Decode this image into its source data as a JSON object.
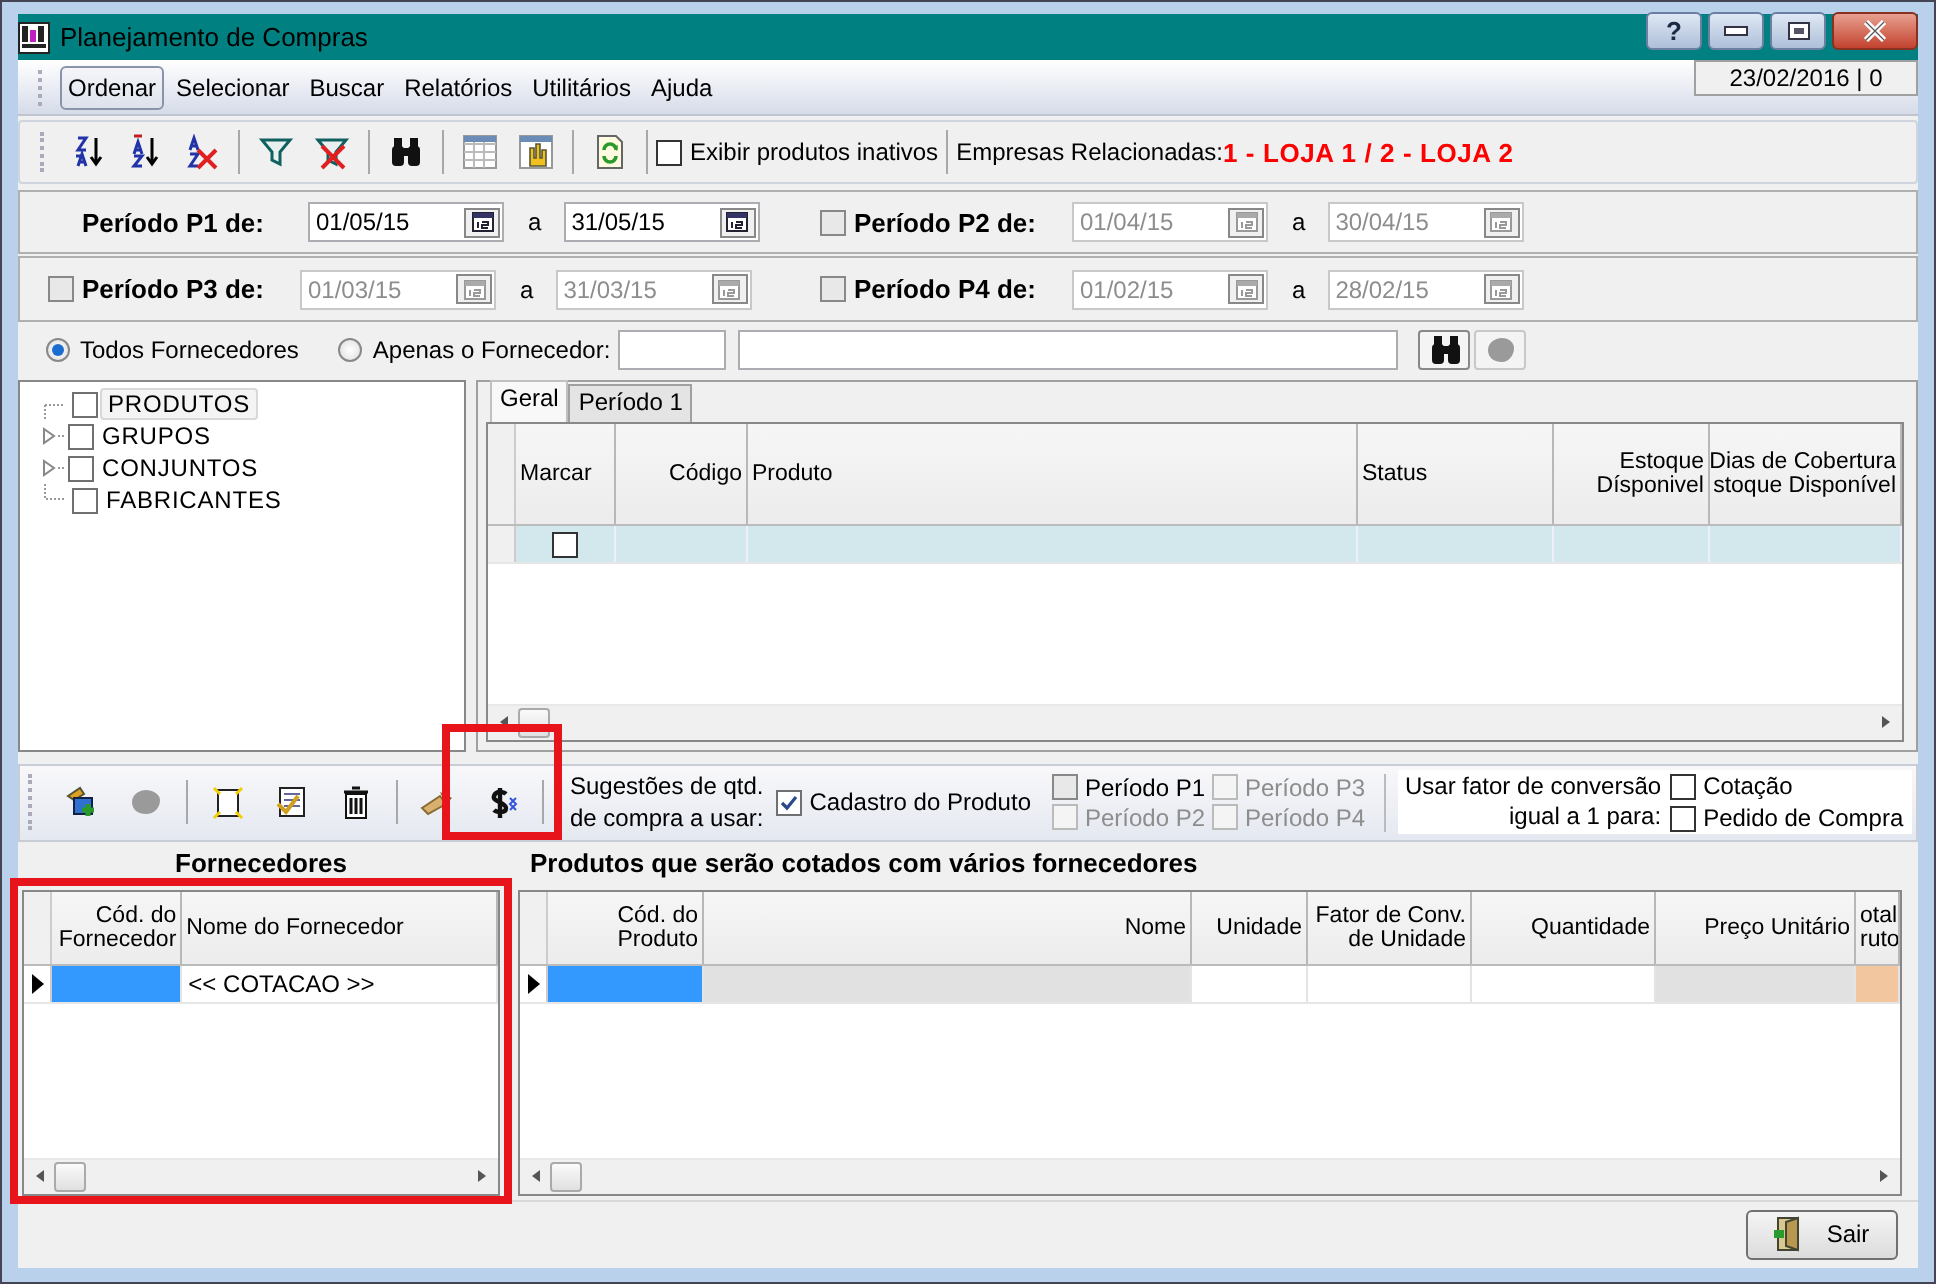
{
  "window": {
    "title": "Planejamento de Compras",
    "help": "?"
  },
  "menu": [
    {
      "label": "Ordenar",
      "selected": true
    },
    {
      "label": "Selecionar",
      "selected": false
    },
    {
      "label": "Buscar",
      "selected": false
    },
    {
      "label": "Relatórios",
      "selected": false
    },
    {
      "label": "Utilitários",
      "selected": false
    },
    {
      "label": "Ajuda",
      "selected": false
    }
  ],
  "date_box": "23/02/2016 | 0",
  "toolbar": {
    "show_inactive": {
      "label": "Exibir produtos inativos",
      "checked": false
    },
    "companies_label": "Empresas Relacionadas:",
    "companies": "1 - LOJA 1 / 2 - LOJA 2"
  },
  "periods": [
    {
      "kind": "fixed",
      "label": "Período P1 de:",
      "from": "01/05/15",
      "to_label": "a",
      "to": "31/05/15"
    },
    {
      "kind": "optional",
      "label": "Período P2 de:",
      "checked": false,
      "from": "01/04/15",
      "to_label": "a",
      "to": "30/04/15"
    },
    {
      "kind": "optional",
      "label": "Período P3 de:",
      "checked": false,
      "from": "01/03/15",
      "to_label": "a",
      "to": "31/03/15"
    },
    {
      "kind": "optional",
      "label": "Período P4 de:",
      "checked": false,
      "from": "01/02/15",
      "to_label": "a",
      "to": "28/02/15"
    }
  ],
  "supplier_filter": [
    {
      "label": "Todos Fornecedores",
      "selected": true
    },
    {
      "label": "Apenas o Fornecedor:",
      "selected": false
    }
  ],
  "tree": [
    {
      "kind": "leaf",
      "label": "PRODUTOS",
      "checked": false,
      "selected": true
    },
    {
      "kind": "group",
      "label": "GRUPOS",
      "checked": false,
      "selected": false
    },
    {
      "kind": "group",
      "label": "CONJUNTOS",
      "checked": false,
      "selected": false
    },
    {
      "kind": "leaf",
      "label": "FABRICANTES",
      "checked": false,
      "selected": false
    }
  ],
  "tabs": [
    {
      "label": "Geral",
      "selected": true
    },
    {
      "label": "Período 1",
      "selected": false
    }
  ],
  "products_grid": {
    "columns": [
      {
        "lines": [
          "Marcar"
        ]
      },
      {
        "lines": [
          "Código"
        ]
      },
      {
        "lines": [
          "Produto"
        ]
      },
      {
        "lines": [
          "Status"
        ]
      },
      {
        "lines": [
          "Estoque",
          "Dísponivel"
        ]
      },
      {
        "lines": [
          "Dias de Cobertura",
          "stoque Disponível"
        ]
      }
    ],
    "rows": [
      {
        "checked": false
      }
    ]
  },
  "suggestions": {
    "lines": [
      "Sugestões de qtd.",
      "de compra a usar:"
    ],
    "options": [
      {
        "label": "Cadastro do Produto",
        "checked": true,
        "disabled": false
      },
      {
        "label": "Período P1",
        "checked": false,
        "disabled": false
      },
      {
        "label": "Período P3",
        "checked": false,
        "disabled": true
      },
      {
        "label": "Período P2",
        "checked": false,
        "disabled": true
      },
      {
        "label": "Período P4",
        "checked": false,
        "disabled": true
      }
    ]
  },
  "conversion": {
    "lines": [
      "Usar fator de conversão",
      "igual a 1 para:"
    ],
    "options": [
      {
        "label": "Cotação",
        "checked": false
      },
      {
        "label": "Pedido de Compra",
        "checked": false
      }
    ]
  },
  "suppliers": {
    "title": "Fornecedores",
    "columns": [
      {
        "lines": [
          "Cód. do",
          "Fornecedor"
        ],
        "kind": "key"
      },
      {
        "lines": [
          "Nome do Fornecedor"
        ],
        "kind": "text"
      }
    ],
    "rows": [
      {
        "current": true,
        "cells": [
          "",
          "<< COTACAO >>"
        ]
      }
    ]
  },
  "quote_products": {
    "title": "Produtos que serão cotados com vários fornecedores",
    "columns": [
      {
        "lines": [
          "Cód. do",
          "Produto"
        ],
        "kind": "key"
      },
      {
        "lines": [
          "Nome"
        ],
        "kind": "readonly"
      },
      {
        "lines": [
          "Unidade"
        ],
        "kind": "editable"
      },
      {
        "lines": [
          "Fator de Conv.",
          "de Unidade"
        ],
        "kind": "editable"
      },
      {
        "lines": [
          "Quantidade"
        ],
        "kind": "editable"
      },
      {
        "lines": [
          "Preço Unitário"
        ],
        "kind": "readonly"
      },
      {
        "lines": [
          "otal",
          "ruto"
        ],
        "kind": "total"
      }
    ],
    "rows": [
      {
        "current": true
      }
    ]
  },
  "highlights": [
    {
      "kind": "frame"
    },
    {
      "kind": "frame"
    }
  ],
  "exit_button": "Sair"
}
